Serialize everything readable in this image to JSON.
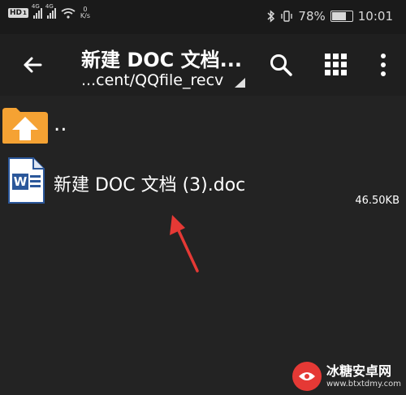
{
  "status_bar": {
    "hd_badge": "HD",
    "sim_badge": "1",
    "signal1_tag": "4G",
    "signal2_tag": "4G",
    "speed_value": "0",
    "speed_unit": "K/s",
    "battery": "78%",
    "battery_level_pct": 78,
    "time": "10:01"
  },
  "toolbar": {
    "title": "新建 DOC 文档...",
    "path": "...cent/QQfile_recv"
  },
  "files": [
    {
      "name": ".."
    },
    {
      "name": "新建 DOC 文档 (3).doc",
      "size": "46.50KB"
    }
  ],
  "colors": {
    "folder": "#f5a233",
    "word_blue": "#2b579a",
    "arrow_red": "#e53935"
  },
  "icons": {
    "back": "arrow-left-icon",
    "search": "search-icon",
    "grid": "grid-icon",
    "more": "more-vertical-icon",
    "parent": "folder-up-icon",
    "doc": "word-doc-icon"
  },
  "watermark": {
    "title": "冰糖安卓网",
    "url": "www.btxtdmy.com"
  }
}
